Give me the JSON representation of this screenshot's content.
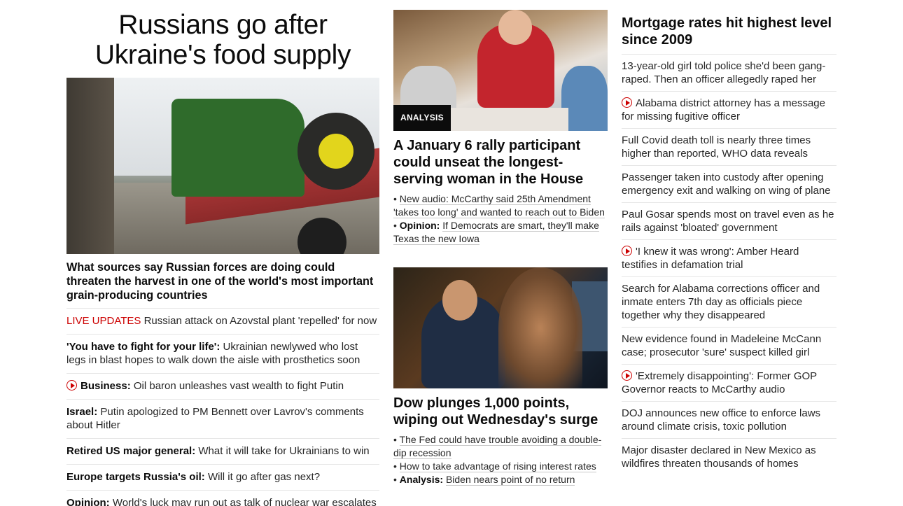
{
  "left": {
    "headline": "Russians go after Ukraine's food supply",
    "subhead": "What sources say Russian forces are doing could threaten the harvest in one of the world's most important grain-producing countries",
    "items": [
      {
        "prefix": "LIVE UPDATES",
        "text": "Russian attack on Azovstal plant 'repelled' for now"
      },
      {
        "prefix": "'You have to fight for your life':",
        "text": "Ukrainian newlywed who lost legs in blast hopes to walk down the aisle with prosthetics soon"
      },
      {
        "prefix": "Business:",
        "text": "Oil baron unleashes vast wealth to fight Putin"
      },
      {
        "prefix": "Israel:",
        "text": "Putin apologized to PM Bennett over Lavrov's comments about Hitler"
      },
      {
        "prefix": "Retired US major general:",
        "text": "What it will take for Ukrainians to win"
      },
      {
        "prefix": "Europe targets Russia's oil:",
        "text": "Will it go after gas next?"
      },
      {
        "prefix": "Opinion:",
        "text": "World's luck may run out as talk of nuclear war escalates"
      }
    ]
  },
  "middle": {
    "badge": "ANALYSIS",
    "story1": {
      "title": "A January 6 rally participant could unseat the longest-serving woman in the House",
      "bullets": [
        {
          "prefix": "",
          "text": "New audio: McCarthy said 25th Amendment 'takes too long' and wanted to reach out to Biden"
        },
        {
          "prefix": "Opinion:",
          "text": "If Democrats are smart, they'll make Texas the new Iowa"
        }
      ]
    },
    "story2": {
      "title": "Dow plunges 1,000 points, wiping out Wednesday's surge",
      "bullets": [
        {
          "prefix": "",
          "text": "The Fed could have trouble avoiding a double-dip recession"
        },
        {
          "prefix": "",
          "text": "How to take advantage of rising interest rates"
        },
        {
          "prefix": "Analysis:",
          "text": "Biden nears point of no return"
        }
      ]
    }
  },
  "right": {
    "title": "Mortgage rates hit highest level since 2009",
    "items": [
      {
        "text": "13-year-old girl told police she'd been gang-raped. Then an officer allegedly raped her"
      },
      {
        "text": "Alabama district attorney has a message for missing fugitive officer"
      },
      {
        "text": "Full Covid death toll is nearly three times higher than reported, WHO data reveals"
      },
      {
        "text": "Passenger taken into custody after opening emergency exit and walking on wing of plane"
      },
      {
        "text": "Paul Gosar spends most on travel even as he rails against 'bloated' government"
      },
      {
        "text": "'I knew it was wrong': Amber Heard testifies in defamation trial"
      },
      {
        "text": "Search for Alabama corrections officer and inmate enters 7th day as officials piece together why they disappeared"
      },
      {
        "text": "New evidence found in Madeleine McCann case; prosecutor 'sure' suspect killed girl"
      },
      {
        "text": "'Extremely disappointing': Former GOP Governor reacts to McCarthy audio"
      },
      {
        "text": "DOJ announces new office to enforce laws around climate crisis, toxic pollution"
      },
      {
        "text": "Major disaster declared in New Mexico as wildfires threaten thousands of homes"
      }
    ]
  },
  "colors": {
    "accent_red": "#cc0000",
    "text": "#262626",
    "divider": "#e6e6e6"
  }
}
